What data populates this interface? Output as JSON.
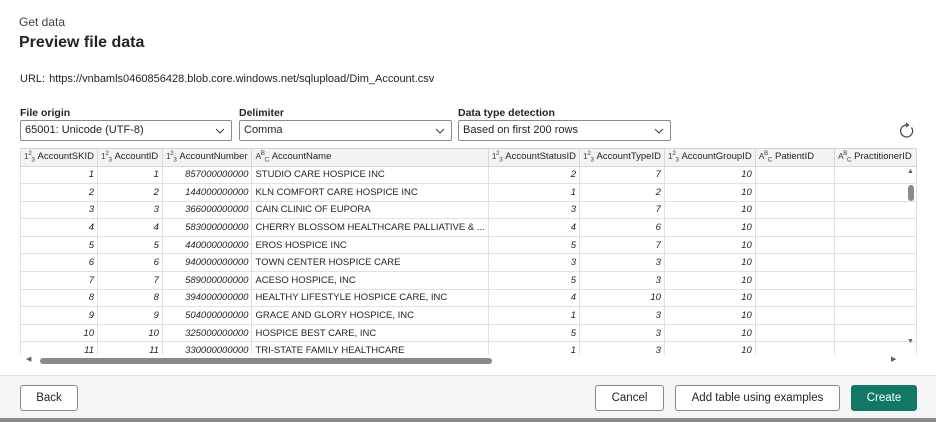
{
  "header": {
    "kicker": "Get data",
    "title": "Preview file data"
  },
  "url": {
    "label": "URL:",
    "value": "https://vnbamls0460856428.blob.core.windows.net/sqlupload/Dim_Account.csv"
  },
  "options": {
    "file_origin": {
      "label": "File origin",
      "value": "65001: Unicode (UTF-8)"
    },
    "delimiter": {
      "label": "Delimiter",
      "value": "Comma"
    },
    "data_type_detection": {
      "label": "Data type detection",
      "value": "Based on first 200 rows"
    }
  },
  "table": {
    "columns": [
      {
        "name": "AccountSKID",
        "type": "number"
      },
      {
        "name": "AccountID",
        "type": "number"
      },
      {
        "name": "AccountNumber",
        "type": "number"
      },
      {
        "name": "AccountName",
        "type": "text"
      },
      {
        "name": "AccountStatusID",
        "type": "number"
      },
      {
        "name": "AccountTypeID",
        "type": "number"
      },
      {
        "name": "AccountGroupID",
        "type": "number"
      },
      {
        "name": "PatientID",
        "type": "text"
      },
      {
        "name": "PractitionerID",
        "type": "text"
      }
    ],
    "rows": [
      [
        "1",
        "1",
        "857000000000",
        "STUDIO CARE HOSPICE INC",
        "2",
        "7",
        "10",
        "",
        ""
      ],
      [
        "2",
        "2",
        "144000000000",
        "KLN COMFORT CARE HOSPICE INC",
        "1",
        "2",
        "10",
        "",
        ""
      ],
      [
        "3",
        "3",
        "366000000000",
        "CAIN CLINIC OF EUPORA",
        "3",
        "7",
        "10",
        "",
        ""
      ],
      [
        "4",
        "4",
        "583000000000",
        "CHERRY BLOSSOM HEALTHCARE PALLIATIVE & ...",
        "4",
        "6",
        "10",
        "",
        ""
      ],
      [
        "5",
        "5",
        "440000000000",
        "EROS HOSPICE INC",
        "5",
        "7",
        "10",
        "",
        ""
      ],
      [
        "6",
        "6",
        "940000000000",
        "TOWN CENTER HOSPICE CARE",
        "3",
        "3",
        "10",
        "",
        ""
      ],
      [
        "7",
        "7",
        "589000000000",
        "ACESO HOSPICE, INC",
        "5",
        "3",
        "10",
        "",
        ""
      ],
      [
        "8",
        "8",
        "394000000000",
        "HEALTHY LIFESTYLE HOSPICE CARE, INC",
        "4",
        "10",
        "10",
        "",
        ""
      ],
      [
        "9",
        "9",
        "504000000000",
        "GRACE AND GLORY HOSPICE, INC",
        "1",
        "3",
        "10",
        "",
        ""
      ],
      [
        "10",
        "10",
        "325000000000",
        "HOSPICE BEST CARE, INC",
        "5",
        "3",
        "10",
        "",
        ""
      ],
      [
        "11",
        "11",
        "330000000000",
        "TRI-STATE FAMILY HEALTHCARE",
        "1",
        "3",
        "10",
        "",
        ""
      ]
    ]
  },
  "buttons": {
    "back": "Back",
    "cancel": "Cancel",
    "add_table": "Add table using examples",
    "create": "Create"
  },
  "colors": {
    "primary": "#117865",
    "header_bg": "#f3f3f3"
  },
  "icons": {
    "number_type": "number-type-icon",
    "text_type": "text-type-icon",
    "dropdown": "chevron-down-icon",
    "refresh": "refresh-icon"
  }
}
